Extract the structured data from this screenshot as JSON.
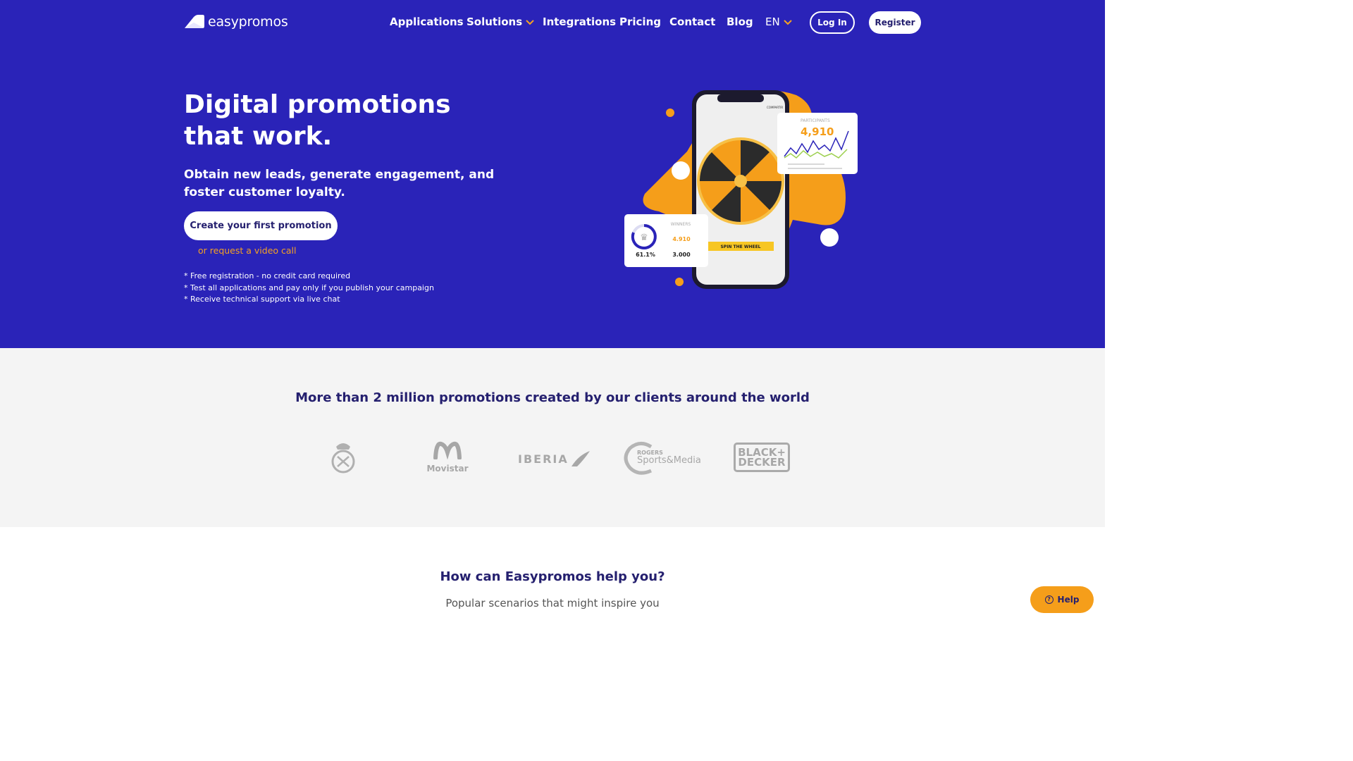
{
  "brand": {
    "name": "easypromos"
  },
  "nav": {
    "items": [
      "Applications",
      "Solutions",
      "Integrations",
      "Pricing",
      "Contact",
      "Blog"
    ],
    "language": "EN",
    "login": "Log In",
    "register": "Register"
  },
  "hero": {
    "title_line1": "Digital promotions",
    "title_line2": "that work.",
    "subtitle": "Obtain new leads, generate engagement, and foster customer loyalty.",
    "cta": "Create your first promotion",
    "video_link": "or request a video call",
    "notes": [
      "* Free registration - no credit card required",
      "* Test all applications and pay only if you publish your campaign",
      "* Receive technical support via live chat"
    ]
  },
  "illustration": {
    "share_label": "COMPARTIR",
    "spin_button": "SPIN THE WHEEL",
    "participants_label": "PARTICIPANTS",
    "participants_value": "4,910",
    "winners_label": "WINNERS",
    "winners_percent": "61.1%",
    "winners_value1": "4.910",
    "winners_value2": "3.000"
  },
  "clients": {
    "title": "More than 2 million promotions created by our clients around the world",
    "logos": [
      "Movistar",
      "IBERIA",
      "ROGERS",
      "Sports&Media",
      "BLACK+",
      "DECKER"
    ]
  },
  "help_section": {
    "title": "How can Easypromos help you?",
    "subtitle": "Popular scenarios that might inspire you"
  },
  "help_widget": {
    "label": "Help"
  },
  "colors": {
    "primary": "#2a23b8",
    "accent": "#f5a221",
    "navy": "#25206f"
  }
}
